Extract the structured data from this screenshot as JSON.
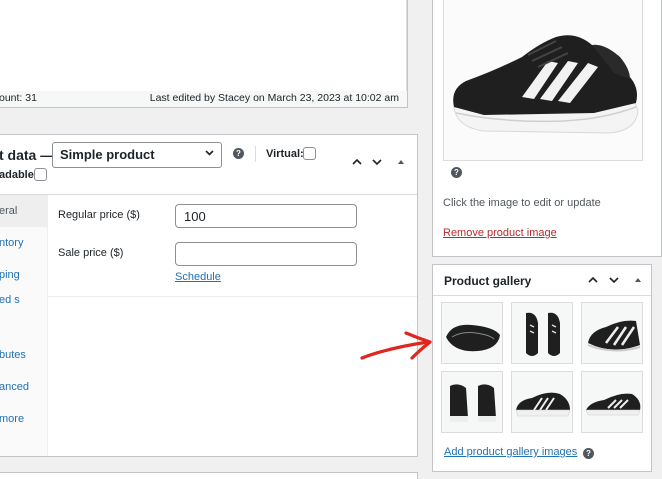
{
  "editor": {
    "word_count": "ount: 31",
    "last_edited": "Last edited by Stacey on March 23, 2023 at 10:02 am"
  },
  "product_data": {
    "title": "t data —",
    "type_select": "Simple product",
    "virtual_label": "Virtual:",
    "downloadable_label": "adable:",
    "tabs": [
      "eral",
      "ntory",
      "ping",
      "ed s",
      "butes",
      "anced",
      "more"
    ],
    "regular_price_label": "Regular price ($)",
    "regular_price_value": "100",
    "sale_price_label": "Sale price ($)",
    "sale_price_value": "",
    "schedule_link": "Schedule"
  },
  "product_image": {
    "help_icon": "?",
    "edit_text": "Click the image to edit or update",
    "remove_link": "Remove product image"
  },
  "product_gallery": {
    "title": "Product gallery",
    "add_link": "Add product gallery images",
    "help_icon": "?",
    "thumbnail_count": 6
  },
  "icons": {
    "chevron_up": "⌃",
    "chevron_down": "⌄",
    "triangle_up": "▲",
    "select_chevron": "⌄"
  },
  "colors": {
    "link": "#2271b1",
    "remove_link": "#b32d2e",
    "arrow": "#e0271f",
    "border": "#c3c4c7"
  }
}
